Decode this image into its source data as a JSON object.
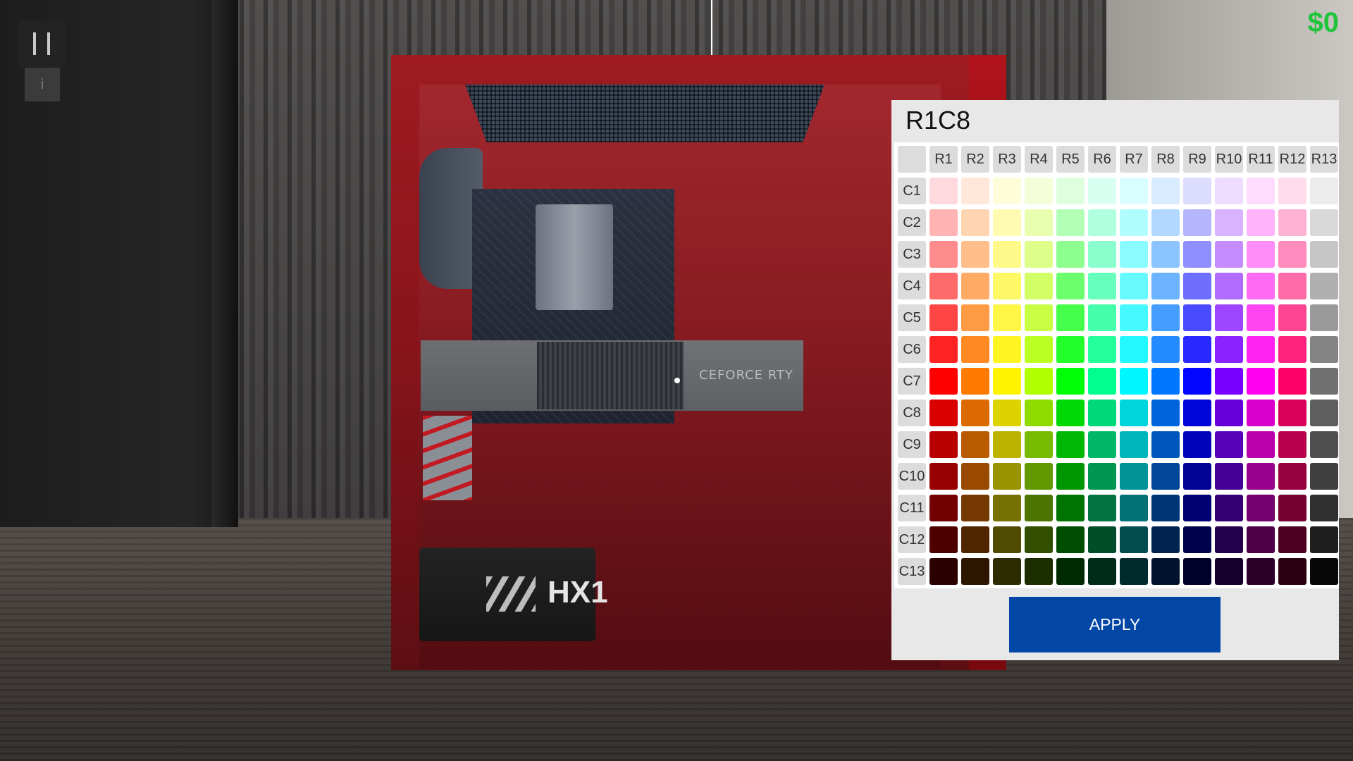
{
  "hud": {
    "money": "$0",
    "info_label": "i"
  },
  "scene": {
    "gpu_label": "CEFORCE RTY",
    "psu_label": "HX1"
  },
  "color_picker": {
    "title": "R1C8",
    "row_headers": [
      "R1",
      "R2",
      "R3",
      "R4",
      "R5",
      "R6",
      "R7",
      "R8",
      "R9",
      "R10",
      "R11",
      "R12",
      "R13"
    ],
    "col_headers": [
      "C1",
      "C2",
      "C3",
      "C4",
      "C5",
      "C6",
      "C7",
      "C8",
      "C9",
      "C10",
      "C11",
      "C12",
      "C13"
    ],
    "colors": [
      [
        "#ffd9dd",
        "#ffe8d9",
        "#fffcd9",
        "#f4ffd9",
        "#ddffdd",
        "#d9fff0",
        "#d9feff",
        "#d9ecff",
        "#dcdcff",
        "#eddcff",
        "#ffdcfd",
        "#ffdcec",
        "#ececec"
      ],
      [
        "#ffb3b3",
        "#ffd4b0",
        "#fffbb0",
        "#e8ffb0",
        "#b3ffb6",
        "#b0ffdf",
        "#b0fdff",
        "#b3d8ff",
        "#b6b6ff",
        "#d9b3ff",
        "#ffb3fb",
        "#ffb3d4",
        "#d9d9d9"
      ],
      [
        "#ff8c8c",
        "#ffbe8a",
        "#fff98a",
        "#ddff8a",
        "#8cff8f",
        "#8affcd",
        "#8afbff",
        "#8cc4ff",
        "#8f8fff",
        "#c48cff",
        "#ff8cf7",
        "#ff8cbd",
        "#c6c6c6"
      ],
      [
        "#ff6b6b",
        "#ffab66",
        "#fff866",
        "#d2ff66",
        "#6bff6e",
        "#66ffbc",
        "#66faff",
        "#6bb2ff",
        "#6e6eff",
        "#b26bff",
        "#ff6bf5",
        "#ff6ba8",
        "#b0b0b0"
      ],
      [
        "#ff4545",
        "#ff9a45",
        "#fff645",
        "#c8ff45",
        "#45ff4a",
        "#45ffab",
        "#45f9ff",
        "#459dff",
        "#4a4aff",
        "#9d45ff",
        "#ff45f2",
        "#ff4592",
        "#9a9a9a"
      ],
      [
        "#ff2323",
        "#ff8a23",
        "#fff523",
        "#bcff23",
        "#23ff28",
        "#23ff9b",
        "#23f8ff",
        "#238aff",
        "#2828ff",
        "#8a23ff",
        "#ff23f0",
        "#ff237e",
        "#848484"
      ],
      [
        "#ff0000",
        "#ff7b00",
        "#fff300",
        "#b2ff00",
        "#00ff06",
        "#00ff8c",
        "#00f7ff",
        "#0077ff",
        "#0006ff",
        "#7700ff",
        "#ff00ee",
        "#ff0069",
        "#707070"
      ],
      [
        "#d90000",
        "#db6a00",
        "#dcd300",
        "#8fdb00",
        "#00d905",
        "#00d977",
        "#00d5dc",
        "#0065db",
        "#0005d9",
        "#6500d9",
        "#d900cb",
        "#d90059",
        "#5e5e5e"
      ],
      [
        "#b80000",
        "#ba5a00",
        "#bbb300",
        "#78ba00",
        "#00b804",
        "#00b865",
        "#00b5bb",
        "#0056ba",
        "#0004b8",
        "#5600b8",
        "#b800ac",
        "#b8004c",
        "#4f4f4f"
      ],
      [
        "#960000",
        "#994900",
        "#999300",
        "#629900",
        "#009603",
        "#009652",
        "#009499",
        "#004699",
        "#000396",
        "#460096",
        "#96008c",
        "#96003e",
        "#3f3f3f"
      ],
      [
        "#730000",
        "#753800",
        "#757000",
        "#4b7500",
        "#007302",
        "#007340",
        "#007175",
        "#003575",
        "#000273",
        "#350073",
        "#73006c",
        "#73002f",
        "#2f2f2f"
      ],
      [
        "#4d0000",
        "#4f2600",
        "#4f4b00",
        "#324f00",
        "#004d02",
        "#004d2a",
        "#004c4f",
        "#00244f",
        "#00024d",
        "#24004d",
        "#4d0048",
        "#4d0020",
        "#1f1f1f"
      ],
      [
        "#2b0000",
        "#2d1500",
        "#2d2b00",
        "#1c2d00",
        "#002b01",
        "#002b18",
        "#002b2d",
        "#00142d",
        "#00012b",
        "#14002b",
        "#2b0028",
        "#2b0012",
        "#080808"
      ]
    ],
    "apply_label": "APPLY"
  }
}
